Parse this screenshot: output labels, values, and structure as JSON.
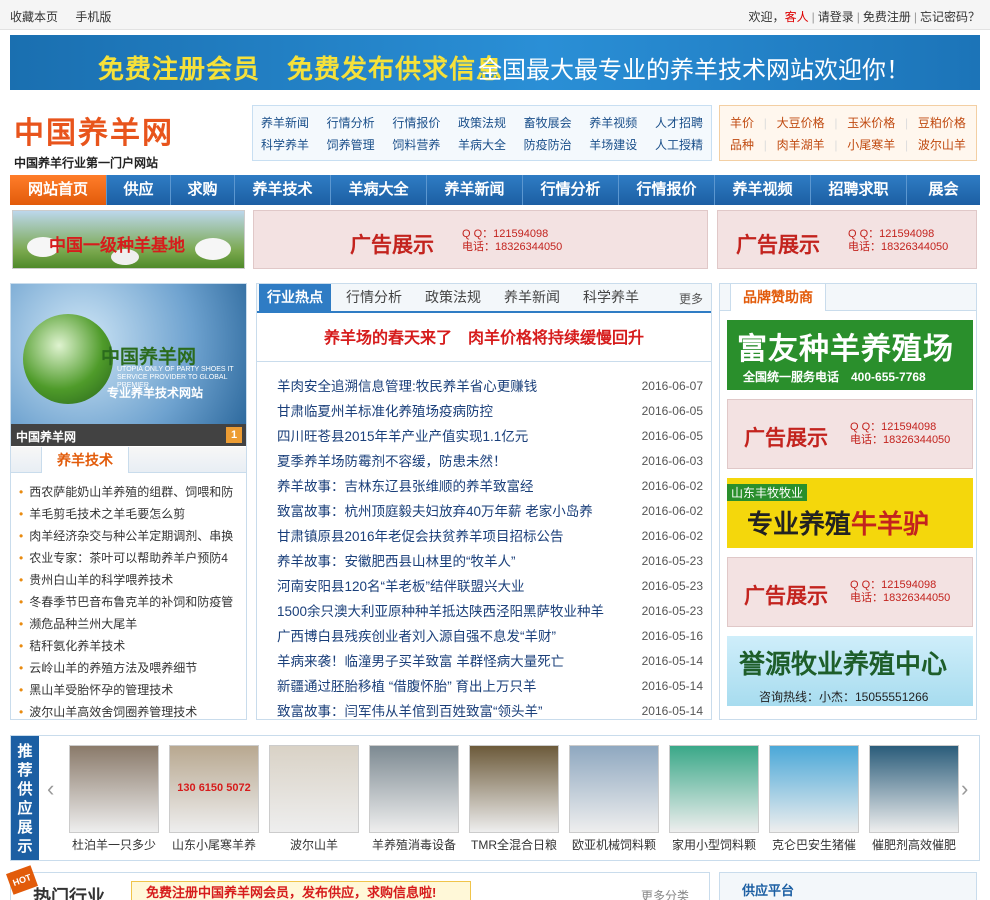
{
  "topbar": {
    "left": [
      "收藏本页",
      "手机版"
    ],
    "welcome": "欢迎，",
    "guest": "客人",
    "login": "请登录",
    "register": "免费注册",
    "forgot": "忘记密码？"
  },
  "banner": {
    "slogan_left": "免费注册会员　免费发布供求信息",
    "slogan_right": "全国最大最专业的养羊技术网站欢迎你！"
  },
  "logo": {
    "title": "中国养羊网",
    "subtitle": "中国养羊行业第一门户网站"
  },
  "quicklinks": {
    "row1": [
      "养羊新闻",
      "行情分析",
      "行情报价",
      "政策法规",
      "畜牧展会",
      "养羊视频",
      "人才招聘"
    ],
    "row2": [
      "科学养羊",
      "饲养管理",
      "饲料营养",
      "羊病大全",
      "防疫防治",
      "羊场建设",
      "人工授精"
    ]
  },
  "pricelinks": {
    "row1": [
      "羊价",
      "大豆价格",
      "玉米价格",
      "豆粕价格"
    ],
    "row2": [
      "品种",
      "肉羊湖羊",
      "小尾寒羊",
      "波尔山羊"
    ]
  },
  "nav": [
    "网站首页",
    "供应",
    "求购",
    "养羊技术",
    "羊病大全",
    "养羊新闻",
    "行情分析",
    "行情报价",
    "养羊视频",
    "招聘求职",
    "展会"
  ],
  "ads": {
    "sheep_banner": "中国一级种羊基地",
    "ad_text": "广告展示",
    "qq": "Q Q：121594098",
    "phone": "电话：18326344050"
  },
  "left": {
    "globe_title": "中国养羊网",
    "globe_sub_en": "UTOPIA ONLY OF PARTY SHOES IT SERVICE PROVIDER TO GLOBAL PREMIER",
    "globe_slogan": "专业养羊技术网站",
    "caption": "中国养羊网",
    "page": "1",
    "tab": "养羊技术",
    "items": [
      "西农萨能奶山羊养殖的组群、饲喂和防",
      "羊毛剪毛技术之羊毛要怎么剪",
      "肉羊经济杂交与种公羊定期调剂、串换",
      "农业专家：茶叶可以帮助养羊户预防4",
      "贵州白山羊的科学喂养技术",
      "冬春季节巴音布鲁克羊的补饲和防疫管",
      "濒危品种兰州大尾羊",
      "秸秆氨化养羊技术",
      "云岭山羊的养殖方法及喂养细节",
      "黑山羊受胎怀孕的管理技术",
      "波尔山羊高效舍饲圈养管理技术"
    ]
  },
  "middle": {
    "tabs": [
      "行业热点",
      "行情分析",
      "政策法规",
      "养羊新闻",
      "科学养羊"
    ],
    "more": "更多",
    "headline": "养羊场的春天来了　肉羊价格将持续缓慢回升",
    "news": [
      {
        "title": "羊肉安全追溯信息管理:牧民养羊省心更赚钱",
        "date": "2016-06-07"
      },
      {
        "title": "甘肃临夏州羊标准化养殖场疫病防控",
        "date": "2016-06-05"
      },
      {
        "title": "四川旺苍县2015年羊产业产值实现1.1亿元",
        "date": "2016-06-05"
      },
      {
        "title": "夏季养羊场防霉剂不容缓，防患未然！",
        "date": "2016-06-03"
      },
      {
        "title": "养羊故事：吉林东辽县张维顺的养羊致富经",
        "date": "2016-06-02"
      },
      {
        "title": "致富故事：杭州顶庭毅夫妇放弃40万年薪 老家小岛养",
        "date": "2016-06-02"
      },
      {
        "title": "甘肃镇原县2016年老促会扶贫养羊项目招标公告",
        "date": "2016-06-02"
      },
      {
        "title": "养羊故事：安徽肥西县山林里的“牧羊人”",
        "date": "2016-05-23"
      },
      {
        "title": "河南安阳县120名“羊老板”结伴联盟兴大业",
        "date": "2016-05-23"
      },
      {
        "title": "1500余只澳大利亚原种种羊抵达陕西泾阳黑萨牧业种羊",
        "date": "2016-05-23"
      },
      {
        "title": "广西博白县残疾创业者刘入源自强不息发“羊财”",
        "date": "2016-05-16"
      },
      {
        "title": "羊病来袭！临潼男子买羊致富 羊群怪病大量死亡",
        "date": "2016-05-14"
      },
      {
        "title": "新疆通过胚胎移植 “借腹怀胎” 育出上万只羊",
        "date": "2016-05-14"
      },
      {
        "title": "致富故事：闫军伟从羊倌到百姓致富“领头羊”",
        "date": "2016-05-14"
      }
    ]
  },
  "right": {
    "tab": "品牌赞助商",
    "fuyou": "富友种羊养殖场",
    "fuyou_phone": "全国统一服务电话　400-655-7768",
    "ad_text": "广告展示",
    "qq": "Q Q：121594098",
    "phone": "电话：18326344050",
    "shandong_tag": "山东丰牧牧业",
    "shandong_a": "专业养殖",
    "shandong_b": "牛羊驴",
    "yuyuan": "誉源牧业养殖中心",
    "yuyuan_phone": "咨询热线：小杰：15055551266"
  },
  "rec": {
    "label": "推荐供应展示",
    "items": [
      "杜泊羊一只多少",
      "山东小尾寒羊养",
      "波尔山羊",
      "羊养殖消毒设备",
      "TMR全混合日粮",
      "欧亚机械饲料颗",
      "家用小型饲料颗",
      "克仑巴安生猪催",
      "催肥剂高效催肥"
    ],
    "phone_overlay": "130 6150 5072"
  },
  "bottom": {
    "hot_badge": "HOT",
    "hot_title": "热门行业",
    "register_notice": "免费注册中国养羊网会员，发布供应，求购信息啦!",
    "more": "更多分类",
    "supply": "供应平台"
  },
  "colors": {
    "nav_blue": "#1c5fa3",
    "nav_active": "#e25b0a",
    "headline_red": "#d61c1c"
  }
}
